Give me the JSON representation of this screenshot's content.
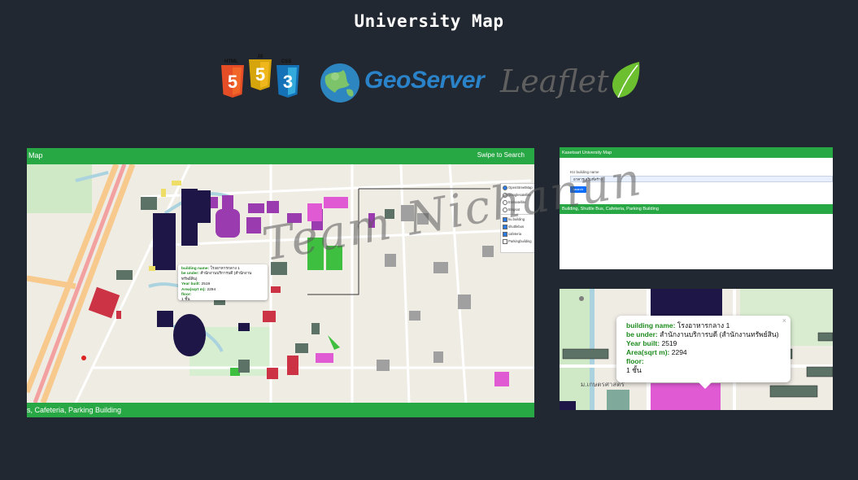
{
  "page": {
    "title": "University Map"
  },
  "logos": {
    "html5": "HTML",
    "js": "JS",
    "css": "CSS",
    "geoserver": "GeoServer",
    "leaflet": "Leaflet"
  },
  "main_panel": {
    "topbar_left": "Map",
    "topbar_right": "Swipe to Search",
    "bottombar": "s, Cafeteria, Parking Building",
    "layers": [
      {
        "label": "OpenStreetMap",
        "type": "radio",
        "checked": true
      },
      {
        "label": "Googlesatellite",
        "type": "radio",
        "checked": false
      },
      {
        "label": "Esrisatellite",
        "type": "radio",
        "checked": false
      },
      {
        "label": "Bingsat",
        "type": "radio",
        "checked": false
      },
      {
        "label": "ku.building",
        "type": "checkbox",
        "checked": true
      },
      {
        "label": "shuttlebus",
        "type": "checkbox",
        "checked": true
      },
      {
        "label": "cafeteria",
        "type": "checkbox",
        "checked": true
      },
      {
        "label": "Parkingbuilding",
        "type": "checkbox",
        "checked": false
      }
    ],
    "popup": {
      "name_label": "building name:",
      "name_value": "โรงอาหารกลาง 1",
      "under_label": "be under:",
      "under_value": "สำนักงานบริการบดี (สำนักงานทรัพย์สิน)",
      "year_label": "Year built:",
      "year_value": "2519",
      "area_label": "Area(sqrt m):",
      "area_value": "2294",
      "floor_label": "floor:",
      "floor_value": "1 ชั้น"
    }
  },
  "search_panel": {
    "header": "Kasetsart University Map",
    "field_label": "KU building name",
    "field_value": "อาคารเสริมที่สร้าง",
    "button": "search",
    "section_header": "Building, Shuttle Bus, Cafeteria, Parking Building"
  },
  "zoom_panel": {
    "popup": {
      "name_label": "building name:",
      "name_value": "โรงอาหารกลาง 1",
      "under_label": "be under:",
      "under_value": "สำนักงานบริการบดี (สำนักงานทรัพย์สิน)",
      "year_label": "Year built:",
      "year_value": "2519",
      "area_label": "Area(sqrt m):",
      "area_value": "2294",
      "floor_label": "floor:",
      "floor_value": "1 ชั้น",
      "close": "×"
    },
    "map_label": "ม.เกษตรศาสตร์"
  },
  "watermark": "Team Nichanun",
  "colors": {
    "background": "#222831",
    "accent_green": "#28a745",
    "building_purple": "#9b3bb0",
    "building_navy": "#1d1646",
    "building_pink": "#e05ad4",
    "building_green": "#3fbf3f",
    "building_red": "#cc3344",
    "building_gray": "#5c7266"
  }
}
